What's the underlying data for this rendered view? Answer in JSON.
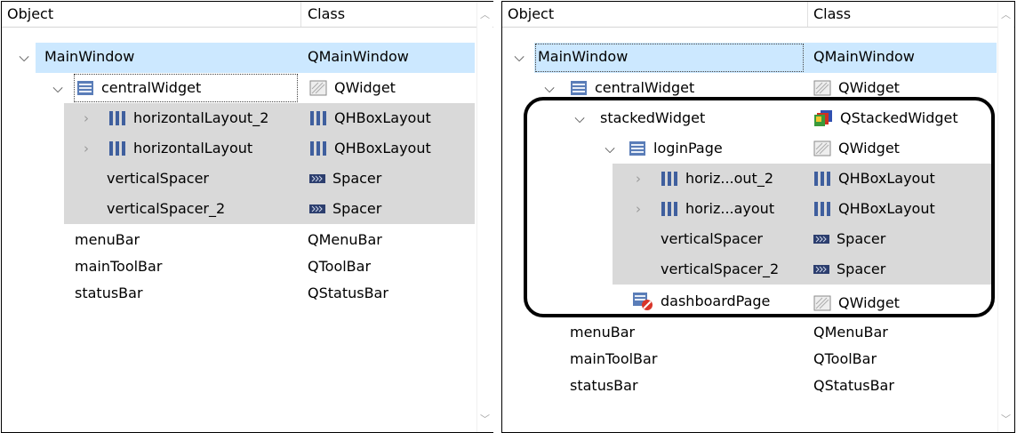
{
  "left": {
    "header": {
      "object": "Object",
      "class": "Class"
    },
    "rows": [
      {
        "name": "MainWindow",
        "class": "QMainWindow"
      },
      {
        "name": "centralWidget",
        "class": "QWidget"
      },
      {
        "name": "horizontalLayout_2",
        "class": "QHBoxLayout"
      },
      {
        "name": "horizontalLayout",
        "class": "QHBoxLayout"
      },
      {
        "name": "verticalSpacer",
        "class": "Spacer"
      },
      {
        "name": "verticalSpacer_2",
        "class": "Spacer"
      },
      {
        "name": "menuBar",
        "class": "QMenuBar"
      },
      {
        "name": "mainToolBar",
        "class": "QToolBar"
      },
      {
        "name": "statusBar",
        "class": "QStatusBar"
      }
    ]
  },
  "right": {
    "header": {
      "object": "Object",
      "class": "Class"
    },
    "rows": [
      {
        "name": "MainWindow",
        "class": "QMainWindow"
      },
      {
        "name": "centralWidget",
        "class": "QWidget"
      },
      {
        "name": "stackedWidget",
        "class": "QStackedWidget"
      },
      {
        "name": "loginPage",
        "class": "QWidget"
      },
      {
        "name": "horiz...out_2",
        "class": "QHBoxLayout"
      },
      {
        "name": "horiz...ayout",
        "class": "QHBoxLayout"
      },
      {
        "name": "verticalSpacer",
        "class": "Spacer"
      },
      {
        "name": "verticalSpacer_2",
        "class": "Spacer"
      },
      {
        "name": "dashboardPage",
        "class": "QWidget"
      },
      {
        "name": "menuBar",
        "class": "QMenuBar"
      },
      {
        "name": "mainToolBar",
        "class": "QToolBar"
      },
      {
        "name": "statusBar",
        "class": "QStatusBar"
      }
    ]
  },
  "colors": {
    "selection": "#cce8ff",
    "layout_row": "#d9d9d9",
    "callout": "#000000"
  }
}
